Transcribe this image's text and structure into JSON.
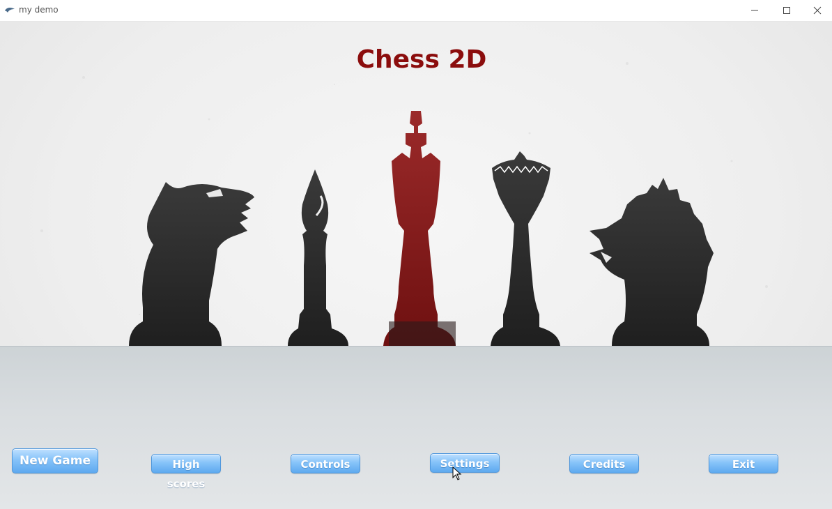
{
  "window": {
    "title": "my demo",
    "icon": "app-icon",
    "controls": [
      "minimize-icon",
      "maximize-icon",
      "close-icon"
    ]
  },
  "game": {
    "title": "Chess 2D",
    "title_color": "#8b0d0d"
  },
  "pieces": [
    "wolf-knight",
    "bishop",
    "king",
    "queen",
    "dragon-knight"
  ],
  "menu": {
    "new_game": "New Game",
    "high_scores": "High scores",
    "controls": "Controls",
    "settings": "Settings",
    "credits": "Credits",
    "exit": "Exit"
  },
  "colors": {
    "button": "#6fb6f5",
    "piece_dark": "#2b2b2b",
    "piece_red": "#8c1a1a"
  }
}
